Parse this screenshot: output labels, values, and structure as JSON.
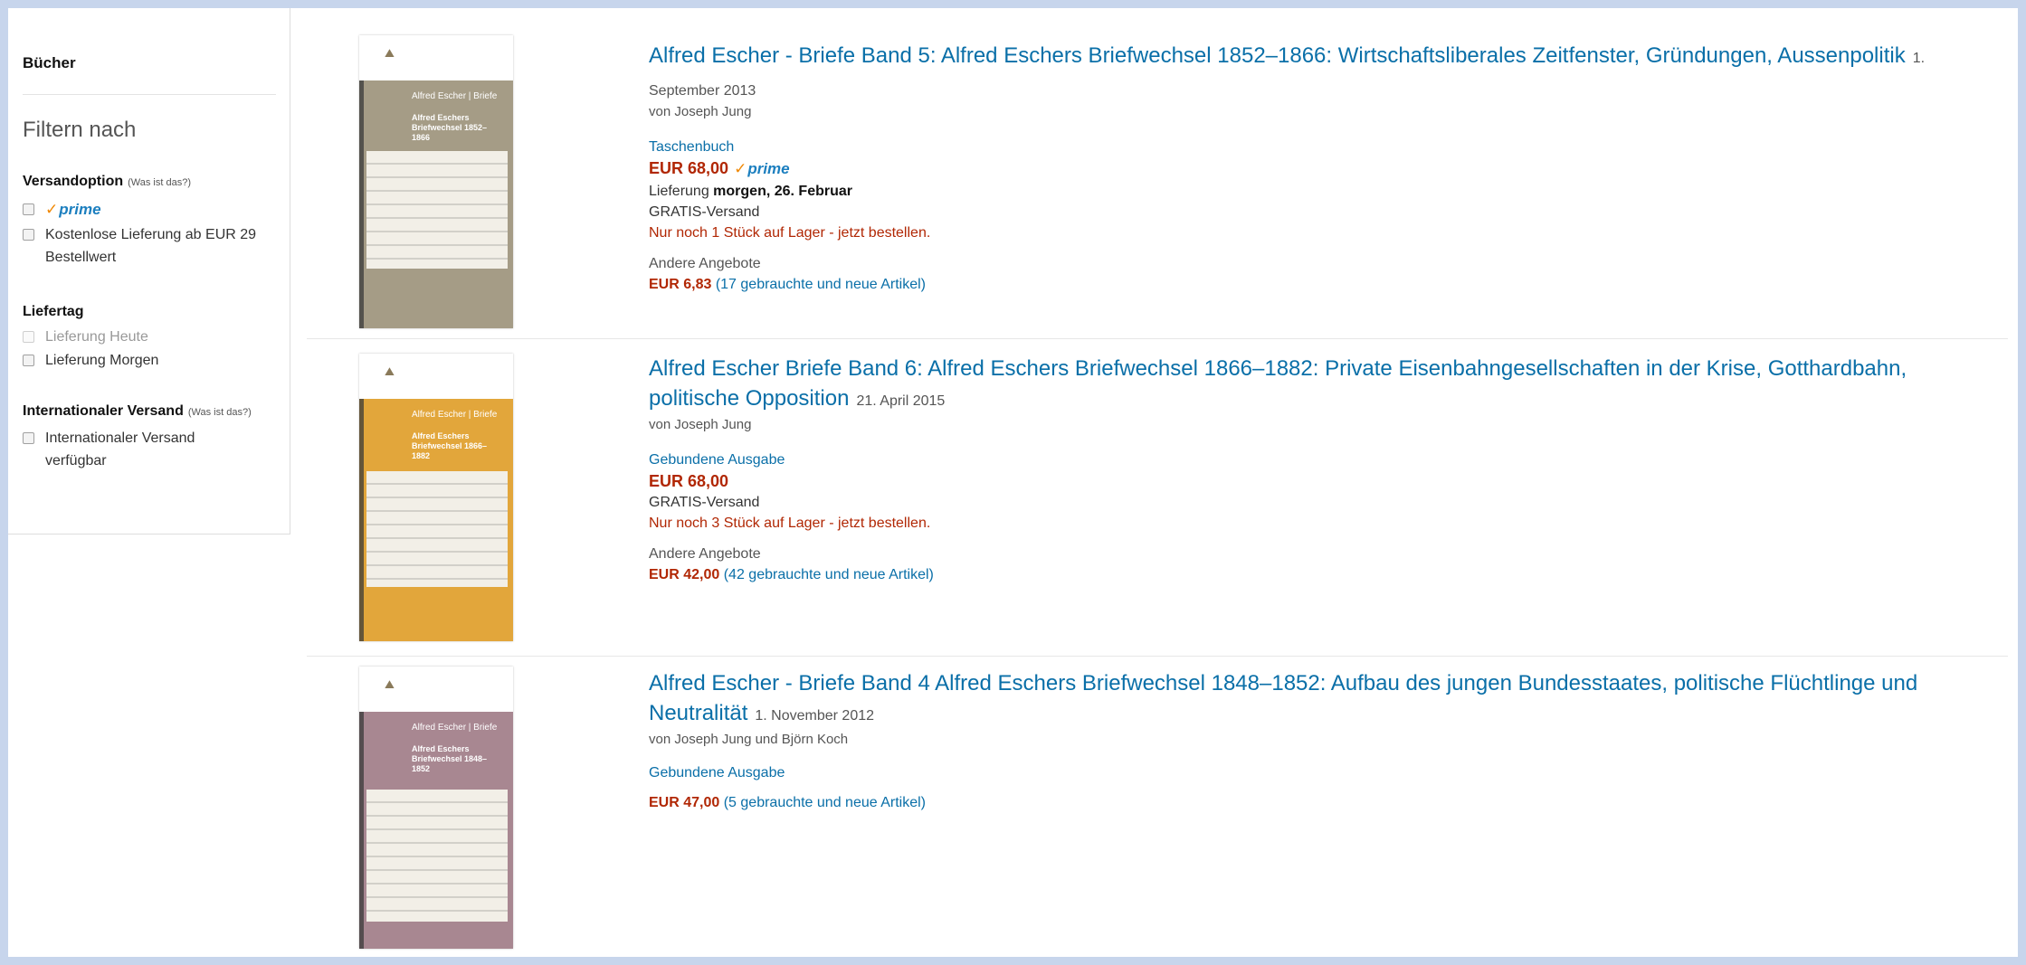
{
  "sidebar": {
    "cutoff_text": "~ ~ ~ ~ ~",
    "category": "Bücher",
    "filter_heading": "Filtern nach",
    "shipping": {
      "heading": "Versandoption",
      "whats_this": "(Was ist das?)",
      "prime_label": "prime",
      "free_delivery_label": "Kostenlose Lieferung ab EUR 29 Bestellwert"
    },
    "delivery_day": {
      "heading": "Liefertag",
      "today_label": "Lieferung Heute",
      "tomorrow_label": "Lieferung Morgen"
    },
    "international": {
      "heading": "Internationaler Versand",
      "whats_this": "(Was ist das?)",
      "available_label": "Internationaler Versand verfügbar"
    }
  },
  "colors": {
    "accent_link": "#0a6fa8",
    "price_red": "#b12704",
    "prime_blue": "#1c7fbf",
    "prime_check": "#f08804",
    "cover1": "#a59c86",
    "cover2": "#e2a63b",
    "cover3": "#a88791"
  },
  "results": [
    {
      "title": "Alfred Escher - Briefe Band 5: Alfred Eschers Briefwechsel 1852–1866: Wirtschaftsliberales Zeitfenster, Gründungen, Aussenpolitik",
      "date": "1. September 2013",
      "author": "von Joseph Jung",
      "format": "Taschenbuch",
      "price": "EUR 68,00",
      "prime": "prime",
      "delivery_prefix": "Lieferung ",
      "delivery_bold": "morgen, 26. Februar",
      "shipping": "GRATIS-Versand",
      "stock": "Nur noch 1 Stück auf Lager - jetzt bestellen.",
      "other_heading": "Andere Angebote",
      "other_price": "EUR 6,83",
      "other_count": "(17 gebrauchte und neue Artikel)",
      "cover": {
        "author": "Alfred Escher | Briefe",
        "title": "Alfred Eschers Briefwechsel 1852–1866"
      }
    },
    {
      "title": "Alfred Escher Briefe Band 6: Alfred Eschers Briefwechsel 1866–1882: Private Eisenbahngesellschaften in der Krise, Gotthardbahn, politische Opposition",
      "date": "21. April 2015",
      "author": "von Joseph Jung",
      "format": "Gebundene Ausgabe",
      "price": "EUR 68,00",
      "shipping": "GRATIS-Versand",
      "stock": "Nur noch 3 Stück auf Lager - jetzt bestellen.",
      "other_heading": "Andere Angebote",
      "other_price": "EUR 42,00",
      "other_count": "(42 gebrauchte und neue Artikel)",
      "cover": {
        "author": "Alfred Escher | Briefe",
        "title": "Alfred Eschers Briefwechsel 1866–1882"
      }
    },
    {
      "title": "Alfred Escher - Briefe Band 4 Alfred Eschers Briefwechsel 1848–1852: Aufbau des jungen Bundesstaates, politische Flüchtlinge und Neutralität",
      "date": "1. November 2012",
      "author": "von Joseph Jung und Björn Koch",
      "format": "Gebundene Ausgabe",
      "other_price": "EUR 47,00",
      "other_count": "(5 gebrauchte und neue Artikel)",
      "cover": {
        "author": "Alfred Escher | Briefe",
        "title": "Alfred Eschers Briefwechsel 1848–1852"
      }
    }
  ]
}
